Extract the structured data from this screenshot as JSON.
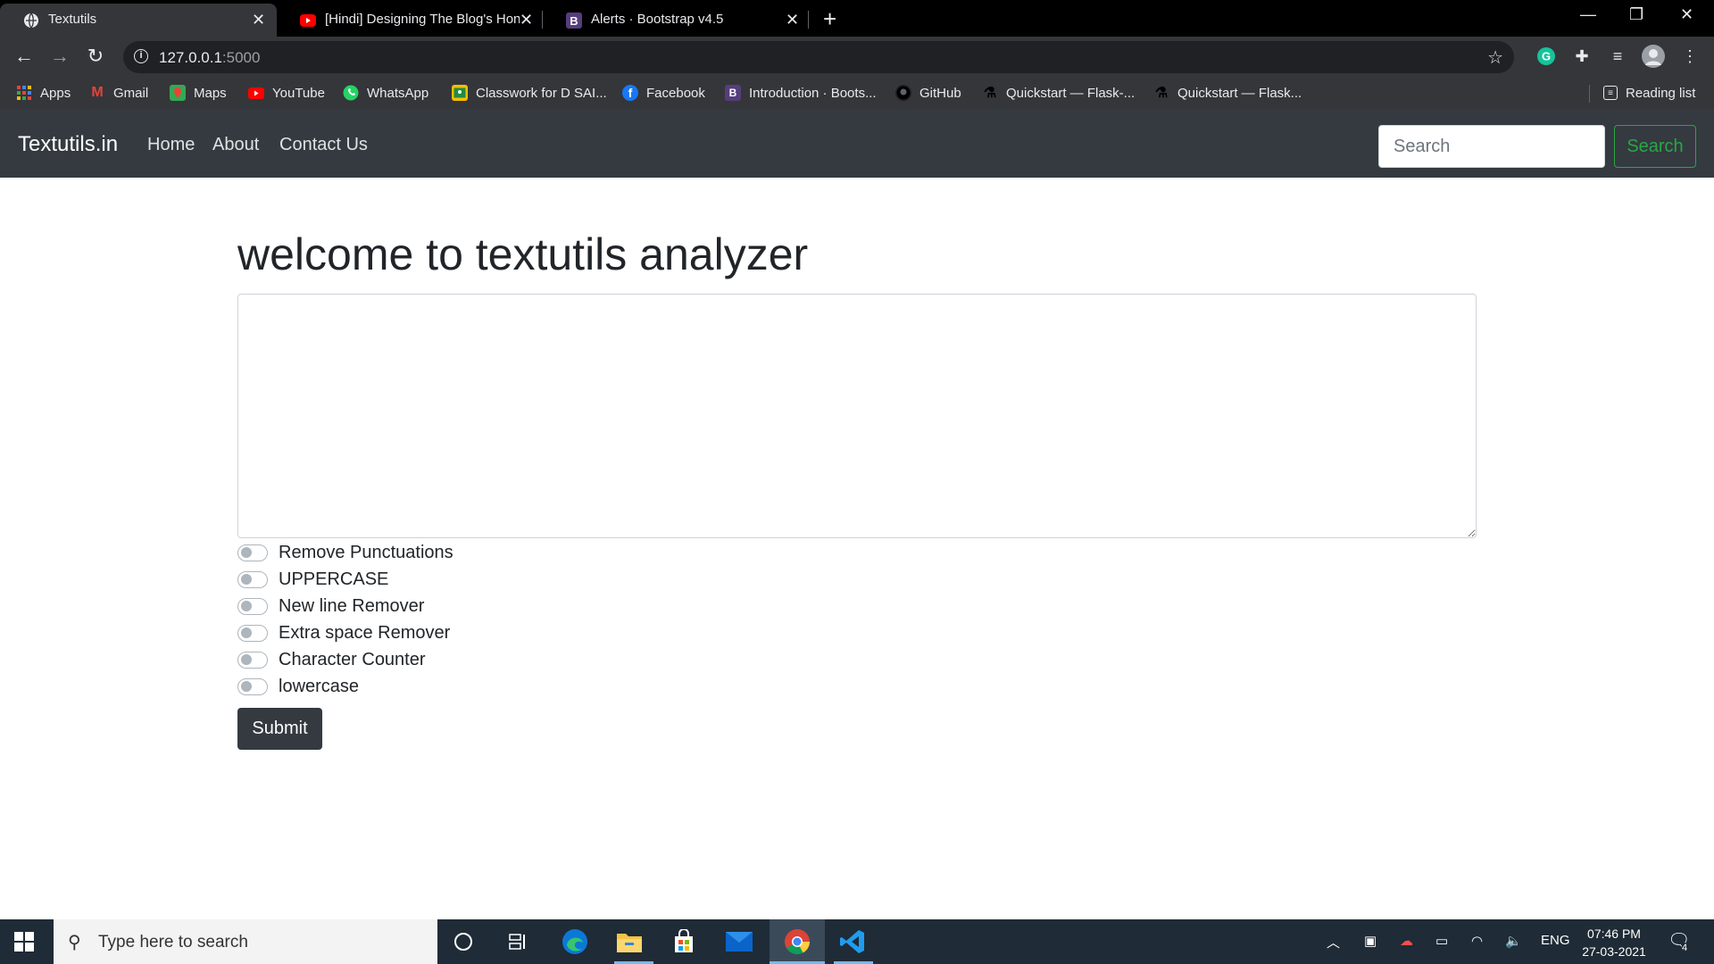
{
  "browser": {
    "tabs": [
      {
        "title": "Textutils",
        "active": true,
        "icon": "globe-icon"
      },
      {
        "title": "[Hindi] Designing The Blog's Hon",
        "active": false,
        "icon": "youtube-icon"
      },
      {
        "title": "Alerts · Bootstrap v4.5",
        "active": false,
        "icon": "bootstrap-icon"
      }
    ],
    "url_host": "127.0.0.1",
    "url_port": ":5000",
    "bookmarks": [
      {
        "label": "Apps",
        "icon": "apps-grid-icon"
      },
      {
        "label": "Gmail",
        "icon": "gmail-icon"
      },
      {
        "label": "Maps",
        "icon": "maps-icon"
      },
      {
        "label": "YouTube",
        "icon": "youtube-icon"
      },
      {
        "label": "WhatsApp",
        "icon": "whatsapp-icon"
      },
      {
        "label": "Classwork for D SAI...",
        "icon": "classroom-icon"
      },
      {
        "label": "Facebook",
        "icon": "facebook-icon"
      },
      {
        "label": "Introduction · Boots...",
        "icon": "bootstrap-icon"
      },
      {
        "label": "GitHub",
        "icon": "github-icon"
      },
      {
        "label": "Quickstart — Flask-...",
        "icon": "flask-icon"
      },
      {
        "label": "Quickstart — Flask...",
        "icon": "flask-icon"
      }
    ],
    "reading_list": "Reading list"
  },
  "navbar": {
    "brand": "Textutils.in",
    "links": [
      "Home",
      "About",
      "Contact Us"
    ],
    "search_placeholder": "Search",
    "search_button": "Search"
  },
  "main": {
    "heading": "welcome to textutils analyzer",
    "textarea_value": "",
    "switches": [
      {
        "label": "Remove Punctuations",
        "checked": false
      },
      {
        "label": "UPPERCASE",
        "checked": false
      },
      {
        "label": "New line Remover",
        "checked": false
      },
      {
        "label": "Extra space Remover",
        "checked": false
      },
      {
        "label": "Character Counter",
        "checked": false
      },
      {
        "label": "lowercase",
        "checked": false
      }
    ],
    "submit_label": "Submit"
  },
  "taskbar": {
    "search_placeholder": "Type here to search",
    "language": "ENG",
    "time": "07:46 PM",
    "date": "27-03-2021",
    "notification_count": "4"
  },
  "colors": {
    "navbar_bg": "#343a40",
    "search_btn": "#28a745",
    "chrome_dark": "#35363a"
  }
}
